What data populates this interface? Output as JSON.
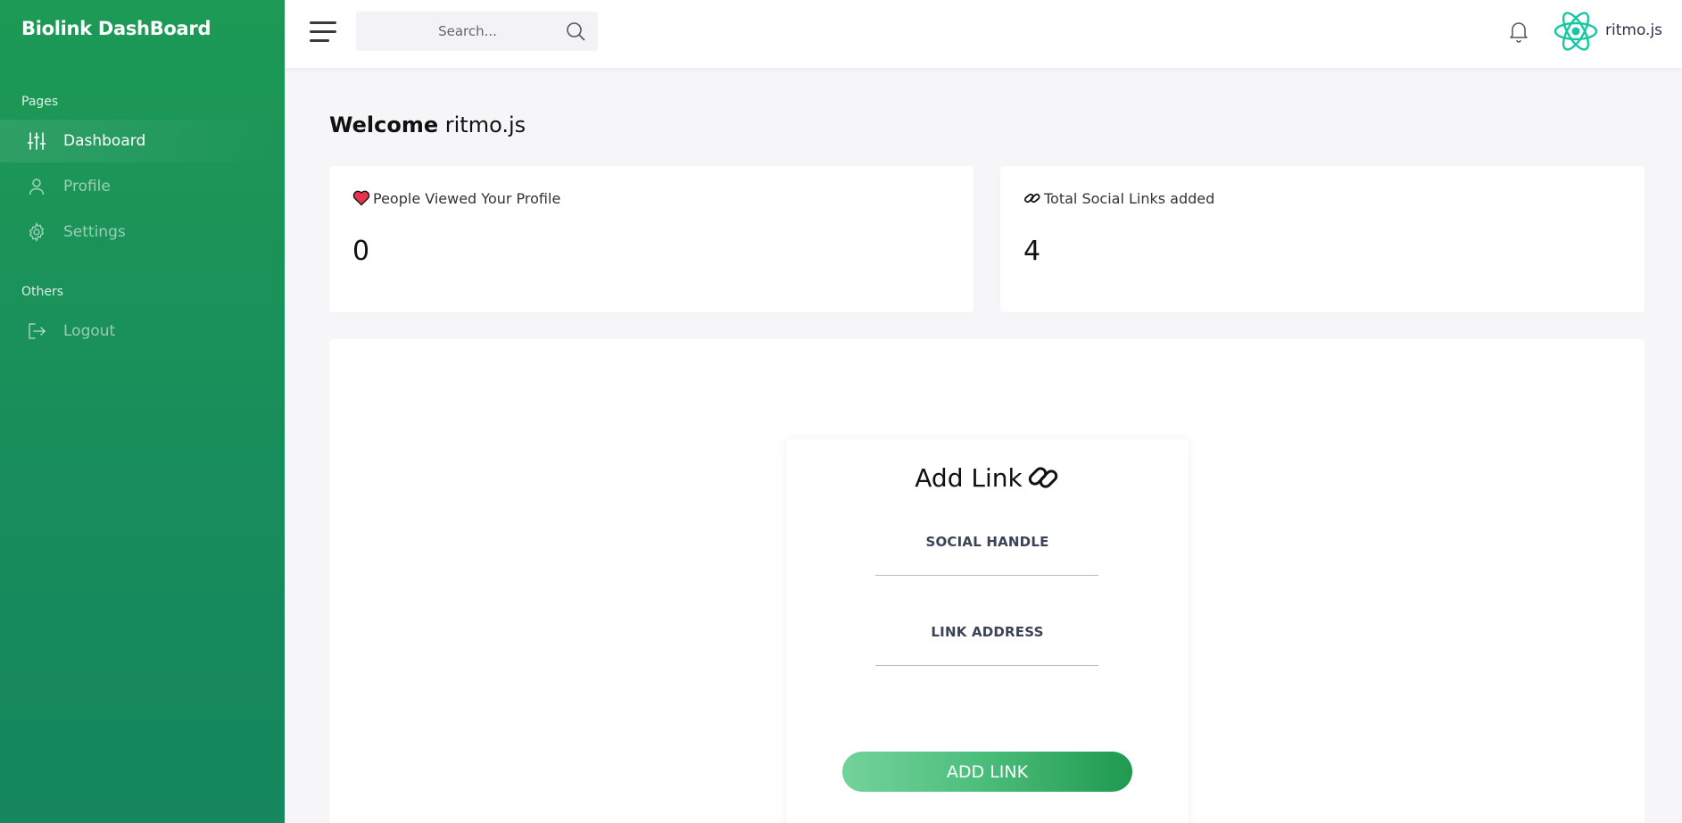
{
  "sidebar": {
    "brand": "Biolink DashBoard",
    "sections": [
      {
        "label": "Pages"
      },
      {
        "label": "Others"
      }
    ],
    "items": [
      {
        "label": "Dashboard",
        "icon": "sliders-icon",
        "active": true
      },
      {
        "label": "Profile",
        "icon": "user-icon",
        "active": false
      },
      {
        "label": "Settings",
        "icon": "gear-icon",
        "active": false
      },
      {
        "label": "Logout",
        "icon": "logout-icon",
        "active": false
      }
    ]
  },
  "topbar": {
    "search_placeholder": "Search...",
    "username": "ritmo.js",
    "avatar_icon": "react-logo-icon"
  },
  "main": {
    "welcome_prefix": "Welcome",
    "welcome_name": "ritmo.js",
    "stats": [
      {
        "title": "People Viewed Your Profile",
        "value": "0",
        "icon": "heart-icon"
      },
      {
        "title": "Total Social Links added",
        "value": "4",
        "icon": "link-icon"
      }
    ],
    "form": {
      "title": "Add Link",
      "title_icon": "link-icon",
      "social_handle_label": "SOCIAL HANDLE",
      "link_address_label": "LINK ADDRESS",
      "social_handle_value": "",
      "link_address_value": "",
      "submit_label": "ADD LINK"
    }
  },
  "colors": {
    "sidebar_green": "#1d9a55",
    "accent_react": "#17c6a3",
    "button_gradient_start": "#73d39b",
    "button_gradient_end": "#1f9a4f"
  }
}
